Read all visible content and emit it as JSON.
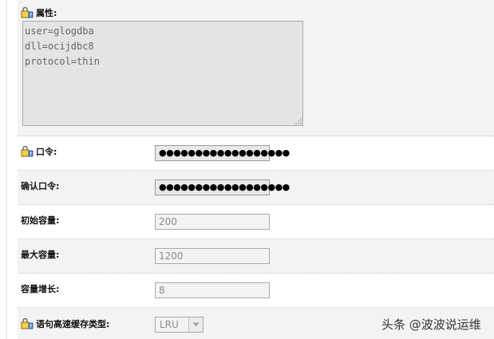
{
  "properties": {
    "label": "属性:",
    "value": "user=glogdba\ndll=ocijdbc8\nprotocol=thin"
  },
  "password": {
    "label": "口令:",
    "value": "●●●●●●●●●●●●●●●●●●"
  },
  "confirm_password": {
    "label": "确认口令:",
    "value": "●●●●●●●●●●●●●●●●●●"
  },
  "initial_capacity": {
    "label": "初始容量:",
    "value": "200"
  },
  "max_capacity": {
    "label": "最大容量:",
    "value": "1200"
  },
  "capacity_increment": {
    "label": "容量增长:",
    "value": "8"
  },
  "statement_cache_type": {
    "label": "语句高速缓存类型:",
    "selected": "LRU"
  },
  "watermark": "头条 @波波说运维",
  "icons": {
    "help": "config-help-icon",
    "dropdown": "chevron-down-icon"
  }
}
